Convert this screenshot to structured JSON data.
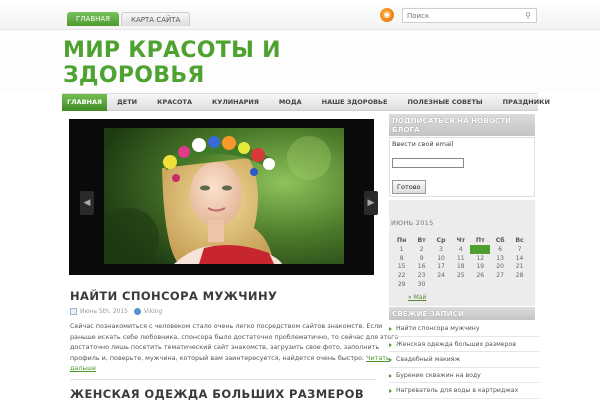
{
  "top_nav": {
    "home": "ГЛАВНАЯ",
    "sitemap": "КАРТА САЙТА"
  },
  "search": {
    "placeholder": "Поиск"
  },
  "site": {
    "title": "МИР КРАСОТЫ И ЗДОРОВЬЯ"
  },
  "main_nav": [
    "ГЛАВНАЯ",
    "ДЕТИ",
    "КРАСОТА",
    "КУЛИНАРИЯ",
    "МОДА",
    "НАШЕ ЗДОРОВЬЕ",
    "ПОЛЕЗНЫЕ СОВЕТЫ",
    "ПРАЗДНИКИ"
  ],
  "posts": [
    {
      "title": "НАЙТИ СПОНСОРА МУЖЧИНУ",
      "date": "Июнь 5th, 2015",
      "author": "Viking",
      "excerpt": "Сейчас познакомиться с человеком стало очень легко посредством сайтов знакомств. Если раньше искать себе любовника, спонсора было достаточно проблематично, то сейчас для этого достаточно лишь посетить тематический сайт знакомств, загрузить свое фото, заполнить профиль и, поверьте, мужчина, который вам заинтересуется, найдется очень быстро.",
      "more": "Читать дальше"
    },
    {
      "title": "ЖЕНСКАЯ ОДЕЖДА БОЛЬШИХ РАЗМЕРОВ"
    }
  ],
  "subscribe": {
    "title": "ПОДПИСАТЬСЯ НА НОВОСТИ БЛОГА",
    "label": "Ввести свой email",
    "button": "Готово"
  },
  "calendar": {
    "caption": "ИЮНЬ 2015",
    "weekdays": [
      "Пн",
      "Вт",
      "Ср",
      "Чт",
      "Пт",
      "Сб",
      "Вс"
    ],
    "weeks": [
      [
        "1",
        "2",
        "3",
        "4",
        "5",
        "6",
        "7"
      ],
      [
        "8",
        "9",
        "10",
        "11",
        "12",
        "13",
        "14"
      ],
      [
        "15",
        "16",
        "17",
        "18",
        "19",
        "20",
        "21"
      ],
      [
        "22",
        "23",
        "24",
        "25",
        "26",
        "27",
        "28"
      ],
      [
        "29",
        "30",
        "",
        "",
        "",
        "",
        ""
      ]
    ],
    "today": "5",
    "prev": "« Май"
  },
  "recent": {
    "title": "СВЕЖИЕ ЗАПИСИ",
    "items": [
      "Найти спонсора мужчину",
      "Женская одежда больших размеров",
      "Свадебный макияж",
      "Бурение скважин на воду",
      "Нагреватель для воды в картриджах"
    ]
  },
  "colors": {
    "accent": "#4ea230",
    "menu_bar": "#e6e6e6",
    "slider_bg": "#0a0a0a"
  },
  "icons": {
    "rss": "rss-icon",
    "search": "search-icon",
    "calendar": "calendar-icon",
    "author": "user-icon"
  }
}
